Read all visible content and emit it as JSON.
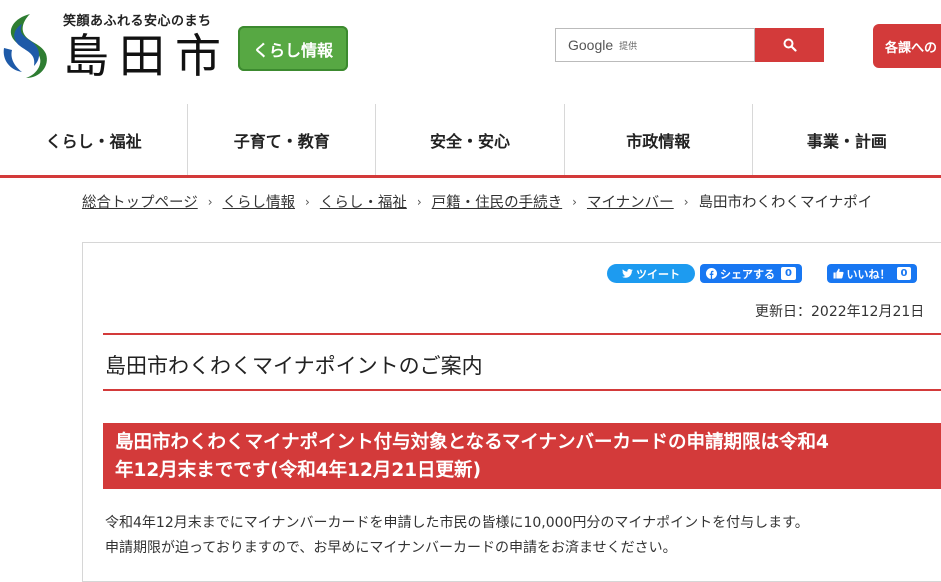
{
  "header": {
    "tagline": "笑顔あふれる安心のまち",
    "city_name": "島田市",
    "kurashi_badge": "くらし情報",
    "search": {
      "brand": "Google",
      "provided": "提供",
      "placeholder": ""
    },
    "dept_button": "各課への"
  },
  "nav": {
    "items": [
      {
        "label": "くらし・福祉"
      },
      {
        "label": "子育て・教育"
      },
      {
        "label": "安全・安心"
      },
      {
        "label": "市政情報"
      },
      {
        "label": "事業・計画"
      }
    ]
  },
  "breadcrumb": {
    "items": [
      {
        "label": "総合トップページ"
      },
      {
        "label": "くらし情報"
      },
      {
        "label": "くらし・福祉"
      },
      {
        "label": "戸籍・住民の手続き"
      },
      {
        "label": "マイナンバー"
      }
    ],
    "current": "島田市わくわくマイナポイ"
  },
  "social": {
    "tweet": "ツイート",
    "share": "シェアする",
    "share_count": "0",
    "like": "いいね！",
    "like_count": "0"
  },
  "page": {
    "updated": "更新日：2022年12月21日",
    "title": "島田市わくわくマイナポイントのご案内",
    "notice_line1": "島田市わくわくマイナポイント付与対象となるマイナンバーカードの申請期限は令和4",
    "notice_line2": "年12月末までです(令和4年12月21日更新)",
    "body_line1": "令和4年12月末までにマイナンバーカードを申請した市民の皆様に10,000円分のマイナポイントを付与します。",
    "body_line2": "申請期限が迫っておりますので、お早めにマイナンバーカードの申請をお済ませください。"
  },
  "colors": {
    "accent_red": "#d33a3a",
    "badge_green": "#57a843",
    "twitter_blue": "#1d9bf0",
    "facebook_blue": "#1877f2"
  }
}
